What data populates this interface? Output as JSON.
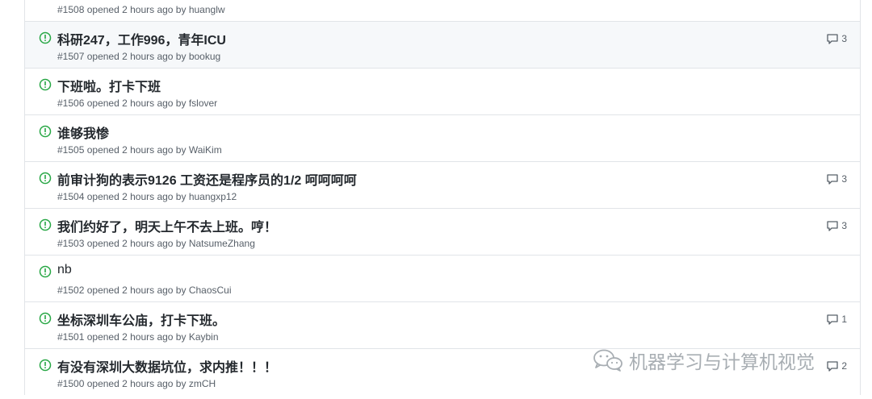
{
  "issues": [
    {
      "title": "",
      "number": "#1508",
      "opened": "opened 2 hours ago by",
      "author": "huanglw",
      "comments": ""
    },
    {
      "title": "科研247，工作996，青年ICU",
      "number": "#1507",
      "opened": "opened 2 hours ago by",
      "author": "bookug",
      "comments": "3"
    },
    {
      "title": "下班啦。打卡下班",
      "number": "#1506",
      "opened": "opened 2 hours ago by",
      "author": "fslover",
      "comments": ""
    },
    {
      "title": "谁够我惨",
      "number": "#1505",
      "opened": "opened 2 hours ago by",
      "author": "WaiKim",
      "comments": ""
    },
    {
      "title": "前审计狗的表示9126 工资还是程序员的1/2 呵呵呵呵",
      "number": "#1504",
      "opened": "opened 2 hours ago by",
      "author": "huangxp12",
      "comments": "3"
    },
    {
      "title": "我们约好了，明天上午不去上班。哼！",
      "number": "#1503",
      "opened": "opened 2 hours ago by",
      "author": "NatsumeZhang",
      "comments": "3"
    },
    {
      "title": "nb",
      "number": "#1502",
      "opened": "opened 2 hours ago by",
      "author": "ChaosCui",
      "comments": ""
    },
    {
      "title": "坐标深圳车公庙，打卡下班。",
      "number": "#1501",
      "opened": "opened 2 hours ago by",
      "author": "Kaybin",
      "comments": "1"
    },
    {
      "title": "有没有深圳大数据坑位，求内推！！！",
      "number": "#1500",
      "opened": "opened 2 hours ago by",
      "author": "zmCH",
      "comments": "2"
    }
  ],
  "icons": {
    "issue": "issue-opened-icon",
    "comment": "comment-icon"
  },
  "colors": {
    "open": "#28a745",
    "border": "#e1e4e8",
    "meta": "#586069",
    "hover_row": "#f6f8fa"
  },
  "watermark": {
    "text": "机器学习与计算机视觉"
  }
}
